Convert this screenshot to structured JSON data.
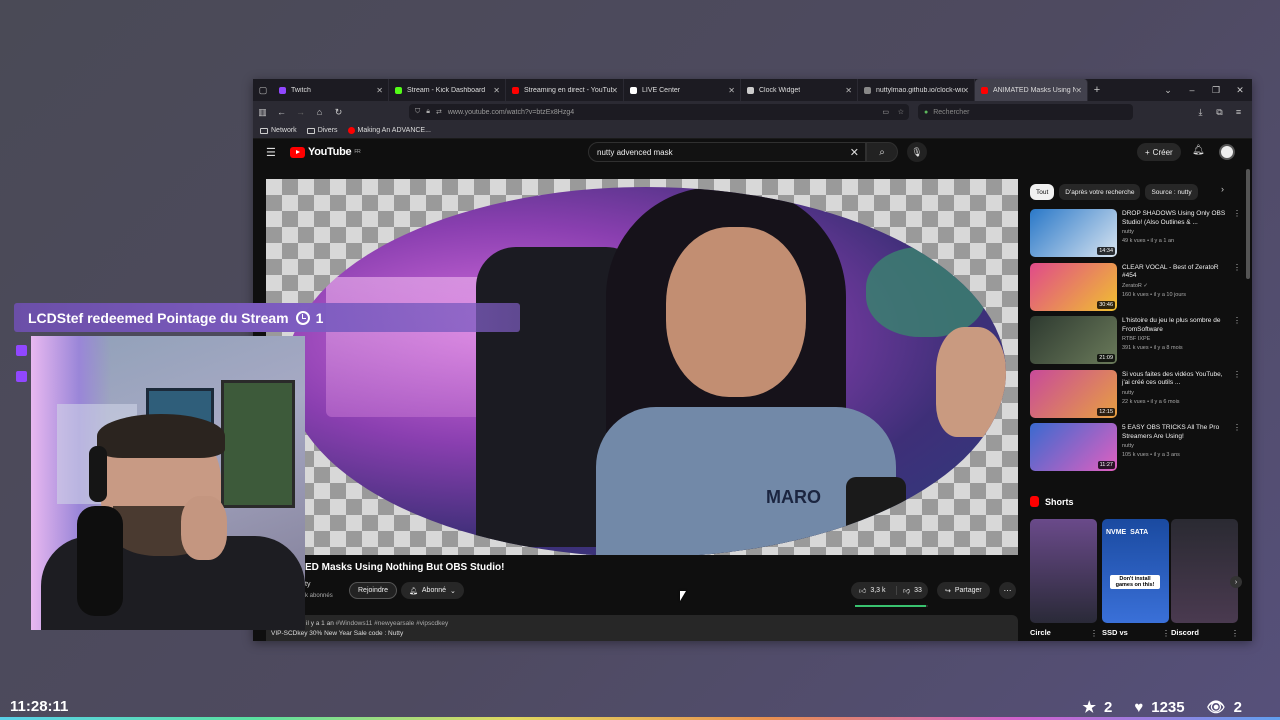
{
  "browser": {
    "tabs": [
      {
        "label": "Twitch",
        "color": "#9147ff"
      },
      {
        "label": "Stream - Kick Dashboard",
        "color": "#53fc18"
      },
      {
        "label": "Streaming en direct - YouTube",
        "color": "#ff0000"
      },
      {
        "label": "LIVE Center",
        "color": "#ffffff"
      },
      {
        "label": "Clock Widget",
        "color": "#cccccc"
      },
      {
        "label": "nuttylmao.github.io/clock-widget/",
        "color": "#888888"
      },
      {
        "label": "ANIMATED Masks Using N",
        "color": "#ff0000",
        "active": true
      }
    ],
    "url": "www.youtube.com/watch?v=btzEx8Hzg4",
    "search_placeholder": "Rechercher",
    "bookmarks": [
      "Network",
      "Divers",
      "Making An ADVANCE..."
    ]
  },
  "youtube": {
    "logo_text": "YouTube",
    "logo_region": "FR",
    "search_query": "nutty advenced mask",
    "create_label": "Créer",
    "video_title": "ED Masks Using Nothing But OBS Studio!",
    "channel": "ty",
    "subscribers": "k abonnés",
    "join_label": "Rejoindre",
    "subscribed_label": "Abonné",
    "likes": "3,3 k",
    "dislikes": "33",
    "like_ratio": 0.97,
    "share_label": "Partager",
    "video_shirt_text": "MARO",
    "desc_line1": "il y a 1 an",
    "desc_tags": "#Windows11 #newyearsale #vipscdkey",
    "desc_line2": "VIP-SCDkey 30% New Year Sale code : Nutty",
    "chips": [
      "Tout",
      "D'après votre recherche",
      "Source : nutty"
    ],
    "recommendations": [
      {
        "title": "DROP SHADOWS Using Only OBS Studio! (Also Outlines & ...",
        "channel": "nutty",
        "meta": "49 k vues • il y a 1 an",
        "duration": "14:34",
        "thumb": [
          "#2a78c8",
          "#d8e4f0"
        ]
      },
      {
        "title": "CLEAR VOCAL - Best of ZeratoR #454",
        "channel": "ZeratoR ✓",
        "meta": "160 k vues • il y a 10 jours",
        "duration": "30:46",
        "thumb": [
          "#e04a8a",
          "#f0c030"
        ]
      },
      {
        "title": "L'histoire du jeu le plus sombre de FromSoftware",
        "channel": "RTBF IXPE",
        "meta": "391 k vues • il y a 8 mois",
        "duration": "21:09",
        "thumb": [
          "#2e3a30",
          "#6a7a5a"
        ]
      },
      {
        "title": "Si vous faites des vidéos YouTube, j'ai créé ces outils ...",
        "channel": "nutty",
        "meta": "22 k vues • il y a 6 mois",
        "duration": "12:15",
        "thumb": [
          "#c84a9a",
          "#e8a040"
        ]
      },
      {
        "title": "5 EASY OBS TRICKS All The Pro Streamers Are Using!",
        "channel": "nutty",
        "meta": "105 k vues • il y a 3 ans",
        "duration": "11:27",
        "thumb": [
          "#3a6ad0",
          "#e060c0"
        ]
      }
    ],
    "shorts_heading": "Shorts",
    "shorts": [
      {
        "label": "Circle",
        "thumb": [
          "#6a4a8a",
          "#2a2a38"
        ]
      },
      {
        "label": "SSD vs",
        "thumb": [
          "#1a4aa0",
          "#3a70d8"
        ],
        "overlay": "NVME  SATA",
        "caption": "Don't install games on this!"
      },
      {
        "label": "Discord",
        "thumb": [
          "#2a2a32",
          "#4a3a50"
        ]
      }
    ]
  },
  "overlay": {
    "redeem_text": "LCDStef redeemed Pointage du Stream",
    "redeem_cost": "1",
    "clock": "11:28:11",
    "stats": [
      {
        "icon": "star-icon",
        "glyph": "★",
        "value": "2"
      },
      {
        "icon": "heart-icon",
        "glyph": "♥",
        "value": "1235"
      },
      {
        "icon": "eye-icon",
        "glyph": "👁",
        "value": "2"
      }
    ]
  }
}
